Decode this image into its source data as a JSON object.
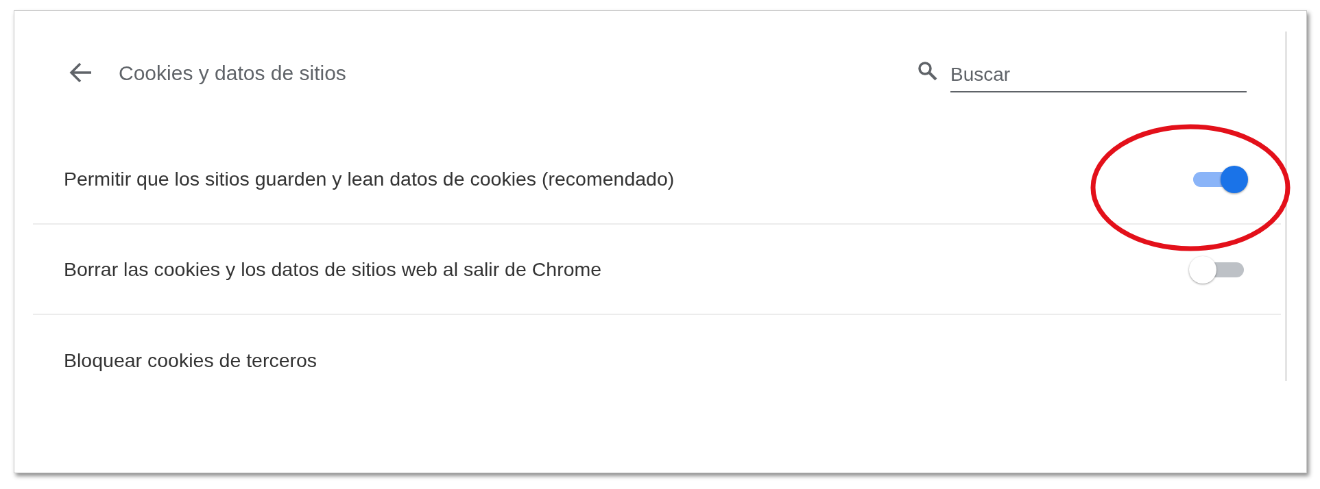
{
  "header": {
    "title": "Cookies y datos de sitios",
    "search": {
      "placeholder": "Buscar"
    }
  },
  "settings": [
    {
      "label": "Permitir que los sitios guarden y lean datos de cookies (recomendado)",
      "kind": "toggle",
      "on": true
    },
    {
      "label": "Borrar las cookies y los datos de sitios web al salir de Chrome",
      "kind": "toggle",
      "on": false
    },
    {
      "label": "Bloquear cookies de terceros",
      "kind": "toggle_hidden"
    }
  ]
}
